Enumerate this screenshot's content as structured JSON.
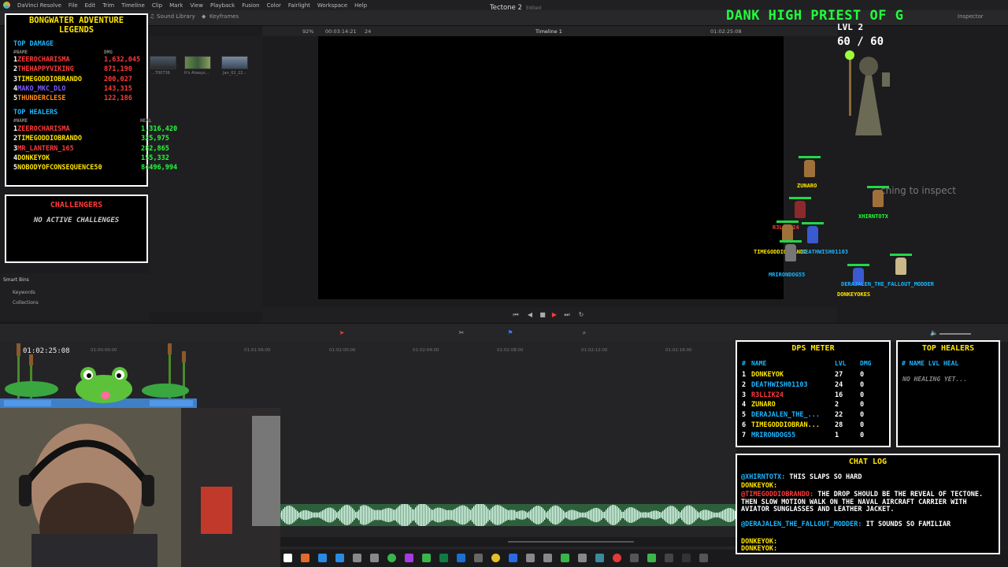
{
  "menubar": {
    "items": [
      "DaVinci Resolve",
      "File",
      "Edit",
      "Trim",
      "Timeline",
      "Clip",
      "Mark",
      "View",
      "Playback",
      "Fusion",
      "Color",
      "Fairlight",
      "Workspace",
      "Help"
    ]
  },
  "toolbar": {
    "sound_library": "Sound Library",
    "keyframes": "Keyframes",
    "project_title": "Tectone 2",
    "edited": "Edited",
    "inspector": "Inspector"
  },
  "viewer": {
    "zoom": "92%",
    "source_tc": "00:03:14:21",
    "fps": "24",
    "timeline_name": "Timeline 1",
    "record_tc": "01:02:25:08"
  },
  "media": {
    "thumbs": [
      {
        "label": "...700736"
      },
      {
        "label": "It's Always..."
      },
      {
        "label": "Jan_02_22..."
      }
    ]
  },
  "bins": {
    "smart_bins": "Smart Bins",
    "keywords": "Keywords",
    "collections": "Collections"
  },
  "timeline": {
    "timecode": "01:02:25:08",
    "ruler": [
      "01:00:00:00",
      "01:01:56:00",
      "01:02:00:00",
      "01:02:04:00",
      "01:02:08:00",
      "01:02:12:00",
      "01:02:16:00"
    ]
  },
  "legends": {
    "title_line1": "BONGWATER ADVENTURE",
    "title_line2": "LEGENDS",
    "top_damage_label": "TOP DAMAGE",
    "name_hdr": "#NAME",
    "dmg_hdr": "DMG",
    "heal_hdr": "HEAL",
    "top_healers_label": "TOP HEALERS",
    "damage": [
      {
        "rank": "1",
        "name": "ZEEROCHARISMA",
        "value": "1,632,045",
        "color": "#ff3a3a",
        "vcolor": "#ff3a3a"
      },
      {
        "rank": "2",
        "name": "THEHAPPYVIKING",
        "value": "871,190",
        "color": "#ff3a3a",
        "vcolor": "#ff3a3a"
      },
      {
        "rank": "3",
        "name": "TIMEGODDIOBRANDO",
        "value": "200,027",
        "color": "#ffe600",
        "vcolor": "#ff3a3a"
      },
      {
        "rank": "4",
        "name": "MAKO_MKC_DLO",
        "value": "143,315",
        "color": "#7a5bff",
        "vcolor": "#ff3a3a"
      },
      {
        "rank": "5",
        "name": "THUNDERCLESE",
        "value": "122,186",
        "color": "#ff8c1a",
        "vcolor": "#ff3a3a"
      }
    ],
    "healers": [
      {
        "rank": "1",
        "name": "ZEEROCHARISMA",
        "value": "1,316,420",
        "color": "#ff3a3a",
        "vcolor": "#22ff3a"
      },
      {
        "rank": "2",
        "name": "TIMEGODDIOBRANDO",
        "value": "325,975",
        "color": "#ffe600",
        "vcolor": "#22ff3a"
      },
      {
        "rank": "3",
        "name": "MR_LANTERN_165",
        "value": "282,865",
        "color": "#ff3a3a",
        "vcolor": "#22ff3a"
      },
      {
        "rank": "4",
        "name": "DONKEYOK",
        "value": "155,332",
        "color": "#ffe600",
        "vcolor": "#22ff3a"
      },
      {
        "rank": "5",
        "name": "NOBODYOFCONSEQUENCE50",
        "value": "84496,994",
        "color": "#ffe600",
        "vcolor": "#22ff3a"
      }
    ]
  },
  "challenges": {
    "title": "CHALLENGERS",
    "message": "NO ACTIVE CHALLENGES"
  },
  "boss": {
    "name": "DANK HIGH PRIEST OF G",
    "level": "LVL 2",
    "hp": "60 / 60",
    "inspect_hint": "ching to inspect"
  },
  "units": [
    {
      "name": "ZUNARO",
      "color": "#ffe600"
    },
    {
      "name": "XHIRNTOTX",
      "color": "#22ff3a"
    },
    {
      "name": "R3LLIK24",
      "color": "#ff3a3a"
    },
    {
      "name": "TIMEGODDIOBRANDO",
      "color": "#ffe600"
    },
    {
      "name": "DEATHWISH01103",
      "color": "#1ab6ff"
    },
    {
      "name": "MRIRONDOG55",
      "color": "#1ab6ff"
    },
    {
      "name": "DERAJALEN_THE_FALLOUT_MODDER",
      "color": "#1ab6ff"
    },
    {
      "name": "DONKEYOKES",
      "color": "#ffe600"
    }
  ],
  "dps": {
    "title": "DPS METER",
    "hdr_rank": "#",
    "hdr_name": "NAME",
    "hdr_lvl": "LVL",
    "hdr_dmg": "DMG",
    "rows": [
      {
        "rank": "1",
        "name": "DONKEYOK",
        "lvl": "27",
        "dmg": "0",
        "color": "#ffe600"
      },
      {
        "rank": "2",
        "name": "DEATHWISH01103",
        "lvl": "24",
        "dmg": "0",
        "color": "#1ab6ff"
      },
      {
        "rank": "3",
        "name": "R3LLIK24",
        "lvl": "16",
        "dmg": "0",
        "color": "#ff3a3a"
      },
      {
        "rank": "4",
        "name": "ZUNARO",
        "lvl": "2",
        "dmg": "0",
        "color": "#ffe600"
      },
      {
        "rank": "5",
        "name": "DERAJALEN_THE_...",
        "lvl": "22",
        "dmg": "0",
        "color": "#1ab6ff"
      },
      {
        "rank": "6",
        "name": "TIMEGODDIOBRAN...",
        "lvl": "28",
        "dmg": "0",
        "color": "#ffe600"
      },
      {
        "rank": "7",
        "name": "MRIRONDOG55",
        "lvl": "1",
        "dmg": "0",
        "color": "#1ab6ff"
      }
    ]
  },
  "top_healers_panel": {
    "title": "TOP HEALERS",
    "hdr": "# NAME  LVL  HEAL",
    "empty": "NO HEALING YET..."
  },
  "chat": {
    "title": "CHAT LOG",
    "lines": [
      {
        "user": "@XHIRNTOTX:",
        "text": " THIS SLAPS SO HARD",
        "ucolor": "#1ab6ff"
      },
      {
        "user": "DONKEYOK:",
        "text": "",
        "ucolor": "#ffe600"
      },
      {
        "user": "@TIMEGODDIOBRANDO:",
        "text": " THE DROP SHOULD BE THE REVEAL OF TECTONE. THEN SLOW MOTION WALK ON THE NAVAL AIRCRAFT CARRIER WITH AVIATOR SUNGLASSES AND LEATHER JACKET.",
        "ucolor": "#ff3a3a"
      },
      {
        "user": "@DERAJALEN_THE_FALLOUT_MODDER:",
        "text": " IT SOUNDS SO FAMILIAR",
        "ucolor": "#1ab6ff"
      },
      {
        "user": "DONKEYOK:",
        "text": "",
        "ucolor": "#ffe600"
      },
      {
        "user": "DONKEYOK:",
        "text": "",
        "ucolor": "#ffe600"
      }
    ]
  }
}
